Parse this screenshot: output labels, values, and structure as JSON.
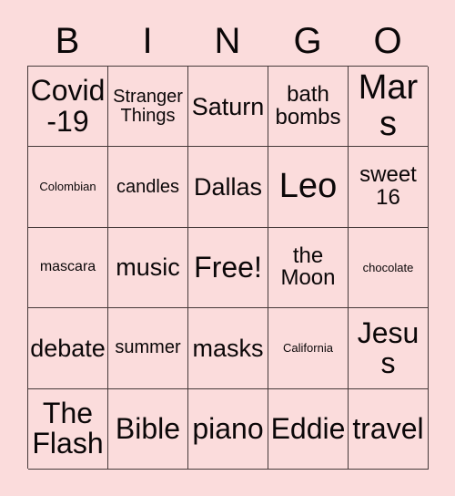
{
  "card": {
    "header_letters": [
      "B",
      "I",
      "N",
      "G",
      "O"
    ],
    "background_color": "#fbdcdc",
    "text_color": "#0b0708",
    "border_color": "#463a3a",
    "rows": [
      [
        {
          "text": "Covid-19",
          "size": "xxl"
        },
        {
          "text": "Stranger Things",
          "size": "md"
        },
        {
          "text": "Saturn",
          "size": "xl"
        },
        {
          "text": "bath bombs",
          "size": "lg"
        },
        {
          "text": "Mars",
          "size": "huge"
        }
      ],
      [
        {
          "text": "Colombian",
          "size": "xs"
        },
        {
          "text": "candles",
          "size": "md"
        },
        {
          "text": "Dallas",
          "size": "xl"
        },
        {
          "text": "Leo",
          "size": "huge"
        },
        {
          "text": "sweet 16",
          "size": "lg"
        }
      ],
      [
        {
          "text": "mascara",
          "size": "sm"
        },
        {
          "text": "music",
          "size": "xl"
        },
        {
          "text": "Free!",
          "size": "xxl"
        },
        {
          "text": "the Moon",
          "size": "lg"
        },
        {
          "text": "chocolate",
          "size": "xs"
        }
      ],
      [
        {
          "text": "debate",
          "size": "xl"
        },
        {
          "text": "summer",
          "size": "md"
        },
        {
          "text": "masks",
          "size": "xl"
        },
        {
          "text": "California",
          "size": "xs"
        },
        {
          "text": "Jesus",
          "size": "xxl"
        }
      ],
      [
        {
          "text": "The Flash",
          "size": "xxl"
        },
        {
          "text": "Bible",
          "size": "xxl"
        },
        {
          "text": "piano",
          "size": "xxl"
        },
        {
          "text": "Eddie",
          "size": "xxl"
        },
        {
          "text": "travel",
          "size": "xxl"
        }
      ]
    ]
  }
}
